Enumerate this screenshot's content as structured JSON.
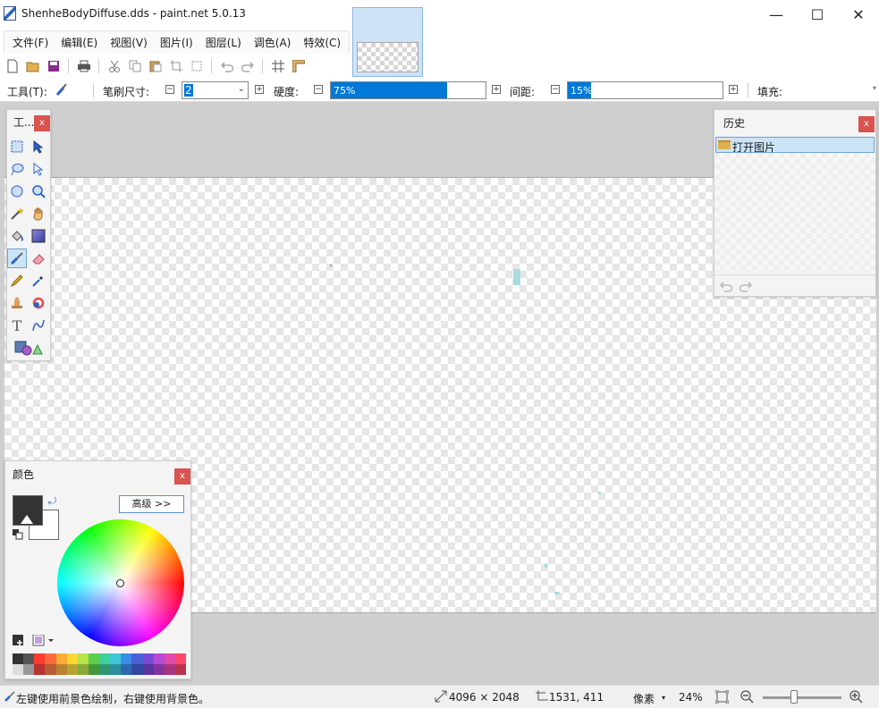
{
  "window": {
    "title": "ShenheBodyDiffuse.dds - paint.net 5.0.13",
    "minimize": "—",
    "maximize": "☐",
    "close": "✕"
  },
  "menu": {
    "items": [
      "文件(F)",
      "编辑(E)",
      "视图(V)",
      "图片(I)",
      "图层(L)",
      "调色(A)",
      "特效(C)"
    ],
    "thumb_arrow": "⌄"
  },
  "tool_options": {
    "tool_label": "工具(T):",
    "brush_size_label": "笔刷尺寸:",
    "brush_size_value": "2",
    "hardness_label": "硬度:",
    "hardness_value": "75%",
    "hardness_percent": 75,
    "spacing_label": "间距:",
    "spacing_value": "15%",
    "spacing_percent": 15,
    "fill_label": "填充:"
  },
  "tools_panel": {
    "title": "工...",
    "close": "x"
  },
  "history_panel": {
    "title": "历史",
    "close": "x",
    "items": [
      "打开图片"
    ]
  },
  "colors_panel": {
    "title": "颜色",
    "close": "x",
    "advanced_label": "高级 >>",
    "primary_color": "#333333",
    "secondary_color": "#ffffff",
    "palette": [
      "#333333",
      "#555555",
      "#ff3b30",
      "#ff6a3d",
      "#ffaa33",
      "#ffd633",
      "#b7e34a",
      "#5ccf4f",
      "#3fcf9a",
      "#3cc6d6",
      "#3b8ee6",
      "#4a5fd6",
      "#7a4ad6",
      "#b44ad6",
      "#e04aa8",
      "#ff4a6a",
      "#dddddd",
      "#999999",
      "#b83232",
      "#b85a32",
      "#b88432",
      "#b8a432",
      "#8aa838",
      "#44983c",
      "#2f9872",
      "#2c909c",
      "#2c6ab0",
      "#3446a0",
      "#5a34a0",
      "#8434a0",
      "#a8347c",
      "#b8344e"
    ]
  },
  "statusbar": {
    "hint": "左键使用前景色绘制，右键使用背景色。",
    "image_size": "4096 × 2048",
    "cursor_pos": "1531, 411",
    "unit": "像素",
    "zoom": "24%",
    "zoom_percent": 24
  }
}
